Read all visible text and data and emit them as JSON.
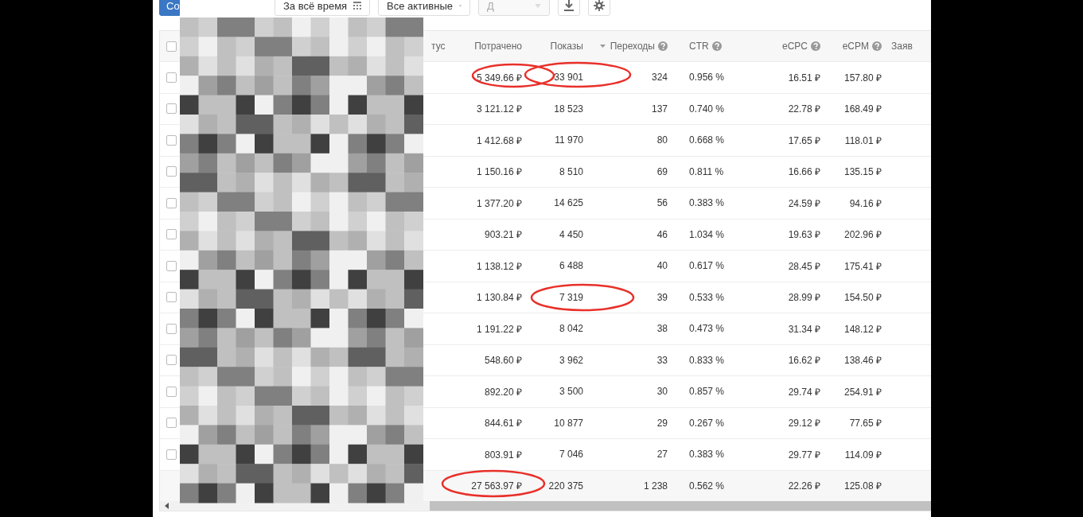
{
  "toolbar": {
    "create_button": "Со",
    "period_button": "За всё время",
    "status_select": "Все активные",
    "disabled_select": {
      "label": "Д",
      "disabled": true
    }
  },
  "table": {
    "select_all": {
      "checked": false
    },
    "status_header": "тус",
    "columns": [
      {
        "label": "Потрачено",
        "help": false,
        "sorted": false
      },
      {
        "label": "Показы",
        "help": false,
        "sorted": false
      },
      {
        "label": "Переходы",
        "help": true,
        "sorted": true
      },
      {
        "label": "CTR",
        "help": true,
        "sorted": false
      },
      {
        "label": "eCPC",
        "help": true,
        "sorted": false
      },
      {
        "label": "eCPM",
        "help": true,
        "sorted": false
      }
    ],
    "cut_header": "Заяв",
    "rows": [
      {
        "checked": false,
        "cells": [
          "5 349.66 ₽",
          "33 901",
          "324",
          "0.956 %",
          "16.51 ₽",
          "157.80 ₽"
        ]
      },
      {
        "checked": false,
        "cells": [
          "3 121.12 ₽",
          "18 523",
          "137",
          "0.740 %",
          "22.78 ₽",
          "168.49 ₽"
        ]
      },
      {
        "checked": false,
        "cells": [
          "1 412.68 ₽",
          "11 970",
          "80",
          "0.668 %",
          "17.65 ₽",
          "118.01 ₽"
        ]
      },
      {
        "checked": false,
        "cells": [
          "1 150.16 ₽",
          "8 510",
          "69",
          "0.811 %",
          "16.66 ₽",
          "135.15 ₽"
        ]
      },
      {
        "checked": false,
        "cells": [
          "1 377.20 ₽",
          "14 625",
          "56",
          "0.383 %",
          "24.59 ₽",
          "94.16 ₽"
        ]
      },
      {
        "checked": false,
        "cells": [
          "903.21 ₽",
          "4 450",
          "46",
          "1.034 %",
          "19.63 ₽",
          "202.96 ₽"
        ]
      },
      {
        "checked": false,
        "cells": [
          "1 138.12 ₽",
          "6 488",
          "40",
          "0.617 %",
          "28.45 ₽",
          "175.41 ₽"
        ]
      },
      {
        "checked": false,
        "cells": [
          "1 130.84 ₽",
          "7 319",
          "39",
          "0.533 %",
          "28.99 ₽",
          "154.50 ₽"
        ]
      },
      {
        "checked": false,
        "cells": [
          "1 191.22 ₽",
          "8 042",
          "38",
          "0.473 %",
          "31.34 ₽",
          "148.12 ₽"
        ]
      },
      {
        "checked": false,
        "cells": [
          "548.60 ₽",
          "3 962",
          "33",
          "0.833 %",
          "16.62 ₽",
          "138.46 ₽"
        ]
      },
      {
        "checked": false,
        "cells": [
          "892.20 ₽",
          "3 500",
          "30",
          "0.857 %",
          "29.74 ₽",
          "254.91 ₽"
        ]
      },
      {
        "checked": false,
        "cells": [
          "844.61 ₽",
          "10 877",
          "29",
          "0.267 %",
          "29.12 ₽",
          "77.65 ₽"
        ]
      },
      {
        "checked": false,
        "cells": [
          "803.91 ₽",
          "7 046",
          "27",
          "0.383 %",
          "29.77 ₽",
          "114.09 ₽"
        ]
      }
    ],
    "total": [
      "27 563.97 ₽",
      "220 375",
      "1 238",
      "0.562 %",
      "22.26 ₽",
      "125.08 ₽"
    ]
  }
}
